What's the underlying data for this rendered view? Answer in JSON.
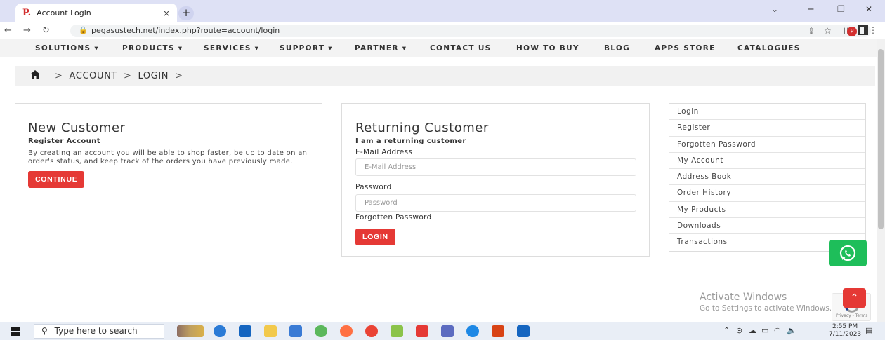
{
  "browser": {
    "tab_title": "Account Login",
    "favicon_letter": "P.",
    "tab_close": "×",
    "new_tab": "+",
    "url": "pegasustech.net/index.php?route=account/login",
    "profile_initial": "P"
  },
  "site_nav": {
    "items": [
      "SOLUTIONS ▾",
      "PRODUCTS ▾",
      "SERVICES ▾",
      "SUPPORT ▾",
      "PARTNER ▾",
      "CONTACT US",
      "HOW TO BUY",
      "BLOG",
      "APPS STORE",
      "CATALOGUES"
    ]
  },
  "breadcrumb": {
    "items": [
      "ACCOUNT",
      "LOGIN"
    ],
    "separator": ">"
  },
  "new_customer": {
    "title": "New Customer",
    "subtitle": "Register Account",
    "description": "By creating an account you will be able to shop faster, be up to date on an order's status, and keep track of the orders you have previously made.",
    "button": "CONTINUE"
  },
  "returning_customer": {
    "title": "Returning Customer",
    "subtitle": "I am a returning customer",
    "email_label": "E-Mail Address",
    "email_placeholder": "E-Mail Address",
    "password_label": "Password",
    "password_placeholder": "Password",
    "forgot_link": "Forgotten Password",
    "button": "LOGIN"
  },
  "account_links": [
    "Login",
    "Register",
    "Forgotten Password",
    "My Account",
    "Address Book",
    "Order History",
    "My Products",
    "Downloads",
    "Transactions"
  ],
  "activate_windows": {
    "line1": "Activate Windows",
    "line2": "Go to Settings to activate Windows."
  },
  "recaptcha_text": "Privacy - Terms",
  "taskbar": {
    "search_placeholder": "Type here to search",
    "time": "2:55 PM",
    "date": "7/11/2023"
  }
}
